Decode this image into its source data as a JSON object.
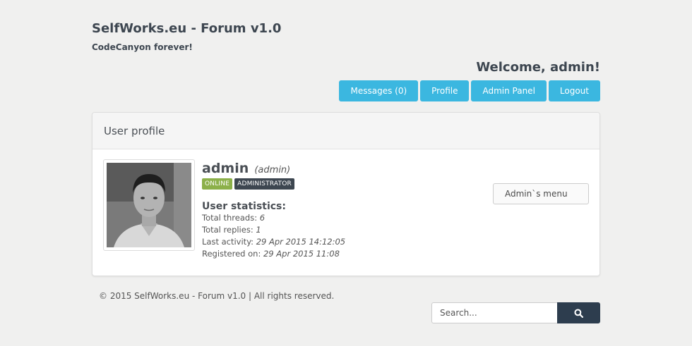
{
  "header": {
    "title": "SelfWorks.eu - Forum v1.0",
    "subtitle": "CodeCanyon forever!",
    "welcome": "Welcome, admin!"
  },
  "nav": {
    "messages": "Messages (0)",
    "profile": "Profile",
    "admin_panel": "Admin Panel",
    "logout": "Logout"
  },
  "panel": {
    "title": "User profile"
  },
  "user": {
    "name": "admin",
    "role_paren": "(admin)",
    "badge_online": "ONLINE",
    "badge_role": "ADMINISTRATOR",
    "stats_title": "User statistics:",
    "threads_label": "Total threads:",
    "threads_value": "6",
    "replies_label": "Total replies:",
    "replies_value": "1",
    "activity_label": "Last activity:",
    "activity_value": "29 Apr 2015 14:12:05",
    "registered_label": "Registered on:",
    "registered_value": "29 Apr 2015 11:08",
    "admin_menu": "Admin`s menu"
  },
  "footer": {
    "copyright": "© 2015 SelfWorks.eu - Forum v1.0 | All rights reserved."
  },
  "search": {
    "placeholder": "Search..."
  },
  "icons": {
    "search": "search-icon"
  },
  "colors": {
    "accent": "#3bb7e0",
    "dark": "#2d3d4e",
    "online": "#8cb04a",
    "admin_badge": "#3d4650"
  }
}
